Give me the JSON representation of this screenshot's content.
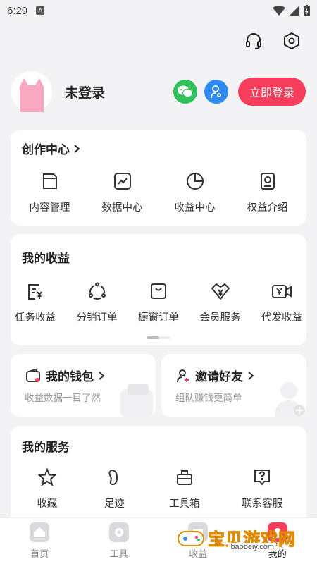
{
  "status_bar": {
    "time": "6:29",
    "a_icon": "A"
  },
  "topbar": {
    "icons": [
      "headset-icon",
      "settings-hexagon-icon"
    ]
  },
  "profile": {
    "username": "未登录",
    "login_button": "立即登录"
  },
  "creator_center": {
    "title": "创作中心",
    "items": [
      {
        "label": "内容管理",
        "icon": "content-icon"
      },
      {
        "label": "数据中心",
        "icon": "chart-icon"
      },
      {
        "label": "收益中心",
        "icon": "pie-icon"
      },
      {
        "label": "权益介绍",
        "icon": "badge-icon"
      }
    ]
  },
  "earnings": {
    "title": "我的收益",
    "items": [
      {
        "label": "任务收益",
        "icon": "task-yen-icon"
      },
      {
        "label": "分销订单",
        "icon": "share-icon"
      },
      {
        "label": "橱窗订单",
        "icon": "shop-bag-icon"
      },
      {
        "label": "会员服务",
        "icon": "vip-icon"
      },
      {
        "label": "代发收益",
        "icon": "video-yen-icon"
      }
    ]
  },
  "wallet": {
    "title": "我的钱包",
    "subtitle": "收益数据一目了然"
  },
  "invite": {
    "title": "邀请好友",
    "subtitle": "组队赚钱更简单"
  },
  "services": {
    "title": "我的服务",
    "items": [
      {
        "label": "收藏",
        "icon": "star-icon"
      },
      {
        "label": "足迹",
        "icon": "footprint-icon"
      },
      {
        "label": "工具箱",
        "icon": "toolbox-icon"
      },
      {
        "label": "联系客服",
        "icon": "help-chat-icon"
      }
    ]
  },
  "tabbar": {
    "tabs": [
      {
        "label": "首页",
        "active": false
      },
      {
        "label": "工具",
        "active": false
      },
      {
        "label": "收益",
        "active": false
      },
      {
        "label": "我的",
        "active": true
      }
    ]
  },
  "watermark": {
    "text": "宝贝游戏网",
    "url": "baobeiy.com"
  },
  "colors": {
    "accent": "#f63d5c",
    "wechat": "#2fc15a",
    "blue": "#2e8af0",
    "background": "#f3f3f5"
  }
}
